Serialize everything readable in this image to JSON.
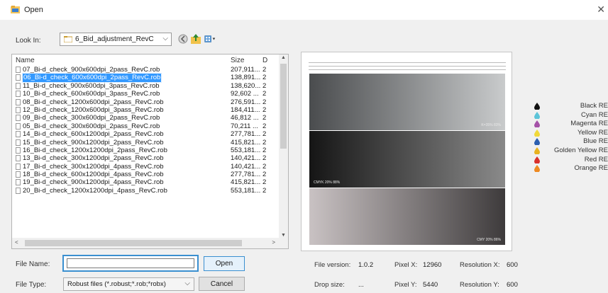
{
  "window": {
    "title": "Open"
  },
  "look_in": {
    "label": "Look In:",
    "value": "6_Bid_adjustment_RevC"
  },
  "toolbar": {
    "icons": [
      "back-icon",
      "up-folder-icon",
      "view-menu-icon"
    ]
  },
  "file_list": {
    "columns": [
      "Name",
      "Size",
      "D"
    ],
    "selected_index": 1,
    "rows": [
      {
        "name": "07_Bi-d_check_900x600dpi_2pass_RevC.rob",
        "size": "207,911...",
        "date": "2"
      },
      {
        "name": "06_Bi-d_check_600x600dpi_2pass_RevC.rob",
        "size": "138,891...",
        "date": "2"
      },
      {
        "name": "11_Bi-d_check_900x600dpi_3pass_RevC.rob",
        "size": "138,620...",
        "date": "2"
      },
      {
        "name": "10_Bi-d_check_600x600dpi_3pass_RevC.rob",
        "size": "92,602 ...",
        "date": "2"
      },
      {
        "name": "08_Bi-d_check_1200x600dpi_2pass_RevC.rob",
        "size": "276,591...",
        "date": "2"
      },
      {
        "name": "12_Bi-d_check_1200x600dpi_3pass_RevC.rob",
        "size": "184,411...",
        "date": "2"
      },
      {
        "name": "09_Bi-d_check_300x600dpi_2pass_RevC.rob",
        "size": "46,812 ...",
        "date": "2"
      },
      {
        "name": "05_Bi-d_check_300x600dpi_2pass_RevC.rob",
        "size": "70,211 ...",
        "date": "2"
      },
      {
        "name": "14_Bi-d_check_600x1200dpi_2pass_RevC.rob",
        "size": "277,781...",
        "date": "2"
      },
      {
        "name": "15_Bi-d_check_900x1200dpi_2pass_RevC.rob",
        "size": "415,821...",
        "date": "2"
      },
      {
        "name": "16_Bi-d_check_1200x1200dpi_2pass_RevC.rob",
        "size": "553,181...",
        "date": "2"
      },
      {
        "name": "13_Bi-d_check_300x1200dpi_2pass_RevC.rob",
        "size": "140,421...",
        "date": "2"
      },
      {
        "name": "17_Bi-d_check_300x1200dpi_4pass_RevC.rob",
        "size": "140,421...",
        "date": "2"
      },
      {
        "name": "18_Bi-d_check_600x1200dpi_4pass_RevC.rob",
        "size": "277,781...",
        "date": "2"
      },
      {
        "name": "19_Bi-d_check_900x1200dpi_4pass_RevC.rob",
        "size": "415,821...",
        "date": "2"
      },
      {
        "name": "20_Bi-d_check_1200x1200dpi_4pass_RevC.rob",
        "size": "553,181...",
        "date": "2"
      }
    ]
  },
  "preview": {
    "bands": [
      {
        "label": "K=35% 83%",
        "from": "#4a4c4e",
        "to": "#c9cbcc"
      },
      {
        "label": "CMYK 20% 88%",
        "from": "#151515",
        "to": "#8a8a8a"
      },
      {
        "label": "CMY 20% 86%",
        "from": "#c9c2c3",
        "to": "#3e3b3c"
      }
    ]
  },
  "inks": [
    {
      "name": "Black RE",
      "color": "#111111"
    },
    {
      "name": "Cyan RE",
      "color": "#5cc4d8"
    },
    {
      "name": "Magenta RE",
      "color": "#a552a8"
    },
    {
      "name": "Yellow RE",
      "color": "#f0d83a"
    },
    {
      "name": "Blue RE",
      "color": "#2c5fb0"
    },
    {
      "name": "Golden Yellow RE",
      "color": "#e8b321"
    },
    {
      "name": "Red RE",
      "color": "#d9302c"
    },
    {
      "name": "Orange RE",
      "color": "#ee8a22"
    }
  ],
  "file_name": {
    "label": "File Name:",
    "value": ""
  },
  "file_type": {
    "label": "File Type:",
    "value": "Robust files (*.robust;*.rob;*robx)"
  },
  "buttons": {
    "open": "Open",
    "cancel": "Cancel"
  },
  "info": {
    "file_version_label": "File version:",
    "file_version": "1.0.2",
    "drop_size_label": "Drop size:",
    "drop_size": "...",
    "pixel_x_label": "Pixel X:",
    "pixel_x": "12960",
    "pixel_y_label": "Pixel Y:",
    "pixel_y": "5440",
    "res_x_label": "Resolution X:",
    "res_x": "600",
    "res_y_label": "Resolution Y:",
    "res_y": "600"
  },
  "colors": {
    "accent": "#3a8fd0",
    "selection": "#3399ff"
  }
}
